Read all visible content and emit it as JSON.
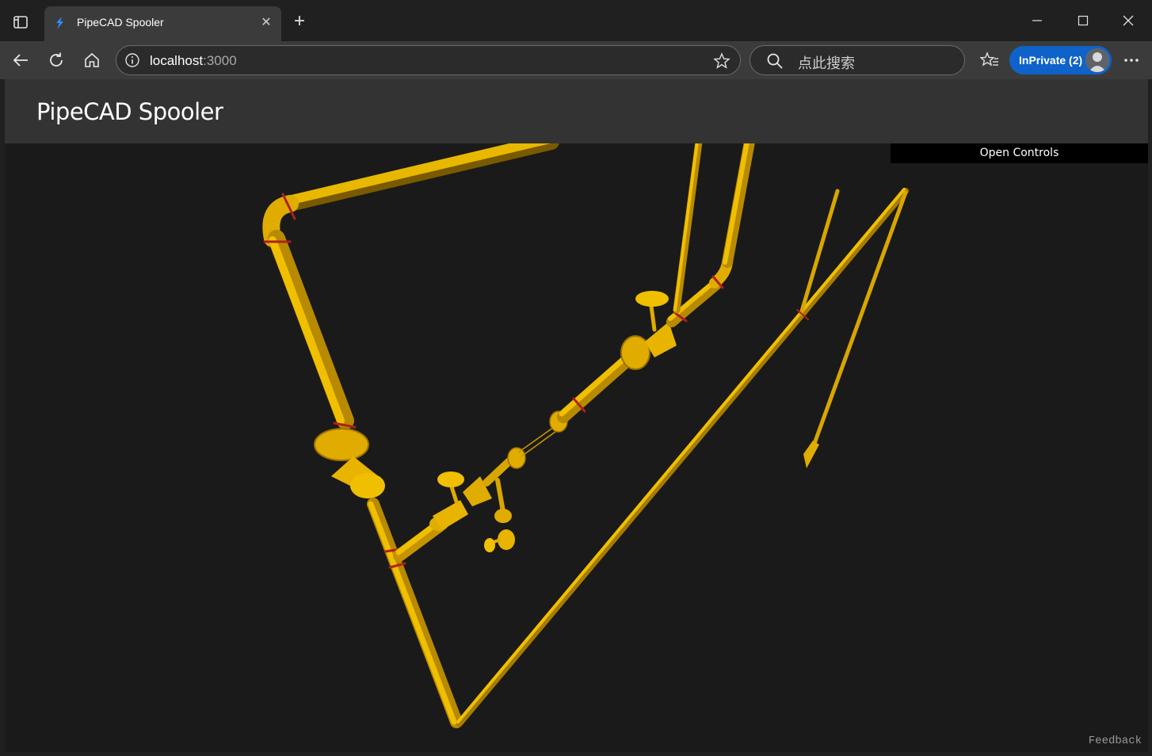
{
  "browser": {
    "tab_title": "PipeCAD Spooler",
    "address_host": "localhost",
    "address_port": ":3000",
    "search_placeholder": "点此搜索",
    "inprivate_label": "InPrivate (2)"
  },
  "app": {
    "title": "PipeCAD Spooler",
    "controls_label": "Open Controls",
    "feedback_label": "Feedback"
  },
  "colors": {
    "pipe": "#e8b800",
    "pipe_dark": "#a67c00",
    "weld": "#b01f1f",
    "background": "#1a1a1a",
    "accent": "#0f62c7"
  }
}
